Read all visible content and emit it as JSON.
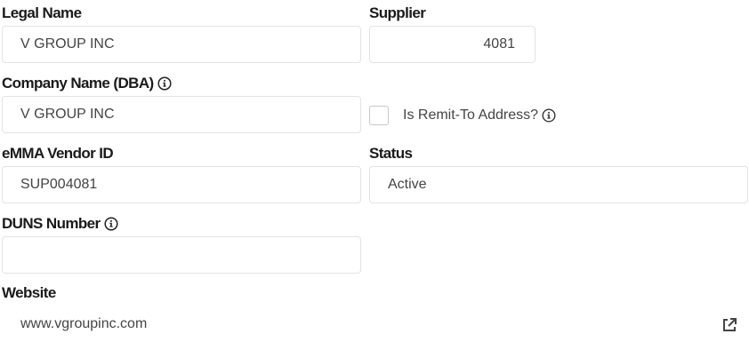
{
  "legal_name": {
    "label": "Legal Name",
    "value": "V GROUP INC"
  },
  "supplier": {
    "label": "Supplier",
    "value": "4081"
  },
  "company_name": {
    "label": "Company Name (DBA)",
    "value": "V GROUP INC",
    "info_icon": "info-circle-icon"
  },
  "remit_to": {
    "label": "Is Remit-To Address?",
    "checked": false,
    "info_icon": "info-circle-icon"
  },
  "emma_vendor_id": {
    "label": "eMMA Vendor ID",
    "value": "SUP004081"
  },
  "status": {
    "label": "Status",
    "value": "Active"
  },
  "duns": {
    "label": "DUNS Number",
    "value": "",
    "info_icon": "info-circle-icon"
  },
  "website": {
    "label": "Website",
    "value": "www.vgroupinc.com",
    "link_icon": "external-link-icon"
  }
}
